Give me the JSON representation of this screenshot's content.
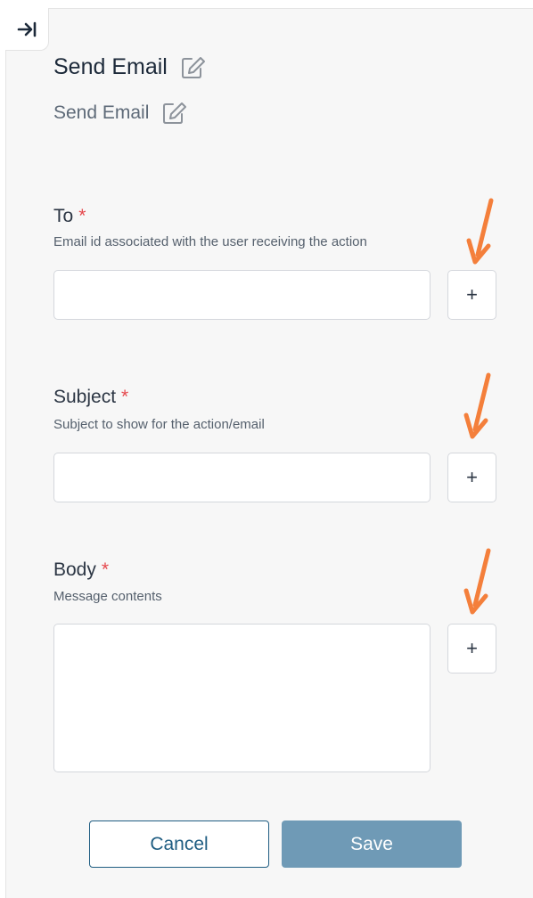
{
  "header": {
    "title": "Send Email",
    "subtitle": "Send Email"
  },
  "icons": {
    "collapse": "arrow-right-to-bar-icon",
    "edit": "pencil-square-icon",
    "add": "plus-icon",
    "annotation": "orange-arrow"
  },
  "fields": {
    "to": {
      "label": "To",
      "required_mark": "*",
      "help": "Email id associated with the user receiving the action",
      "value": "",
      "add_label": "+"
    },
    "subject": {
      "label": "Subject",
      "required_mark": "*",
      "help": "Subject to show for the action/email",
      "value": "",
      "add_label": "+"
    },
    "body": {
      "label": "Body",
      "required_mark": "*",
      "help": "Message contents",
      "value": "",
      "add_label": "+"
    }
  },
  "actions": {
    "cancel_label": "Cancel",
    "save_label": "Save"
  },
  "colors": {
    "accent": "#1f5d82",
    "save_bg": "#6f9ab6",
    "required": "#e5484d",
    "annotation_arrow": "#f47f3b",
    "panel_bg": "#f7f7f7"
  }
}
